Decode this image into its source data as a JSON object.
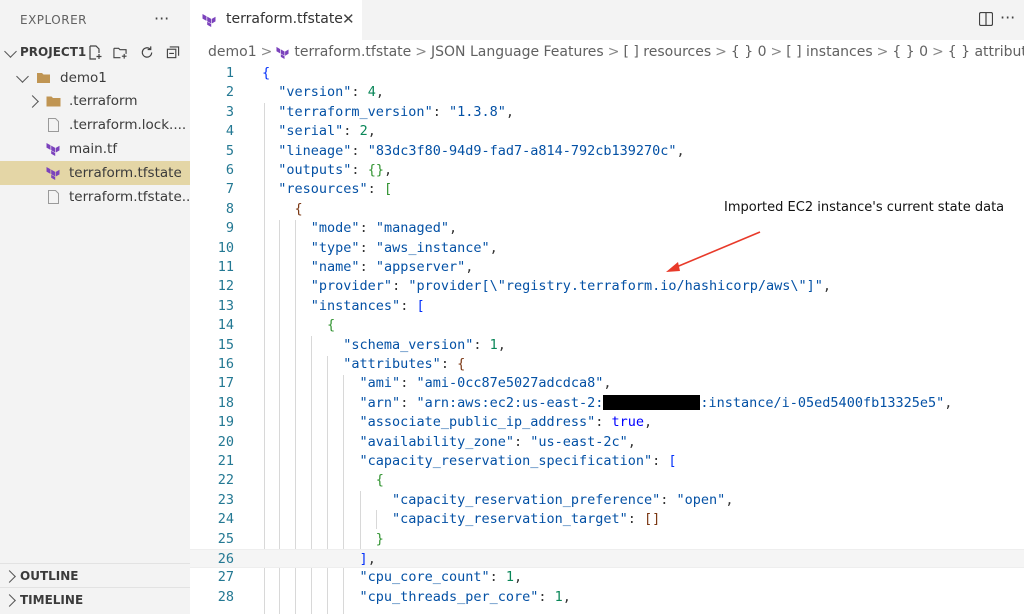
{
  "sidebar": {
    "header": "EXPLORER",
    "more": "···",
    "project": "PROJECT1",
    "tree": [
      {
        "label": "demo1"
      },
      {
        "label": ".terraform"
      },
      {
        "label": ".terraform.lock...."
      },
      {
        "label": "main.tf"
      },
      {
        "label": "terraform.tfstate"
      },
      {
        "label": "terraform.tfstate..."
      }
    ],
    "outline": "OUTLINE",
    "timeline": "TIMELINE"
  },
  "editor": {
    "tab": {
      "label": "terraform.tfstate",
      "close": "✕"
    },
    "more": "···",
    "breadcrumb": {
      "b0": "demo1",
      "b1": "terraform.tfstate",
      "b2": "JSON Language Features",
      "b3": "[ ] resources",
      "b4": "{ } 0",
      "b5": "[ ] instances",
      "b6": "{ } 0",
      "b7": "{ } attributes"
    }
  },
  "annotation": "Imported EC2 instance's current state data",
  "code": {
    "l4_key": "\"serial\"",
    "l5_key": "\"lineage\"",
    "l5_val": "\"83dc3f80-94d9-fad7-a814-792cb139270c\"",
    "l12_val": "\"provider[\\\"registry.terraform.io/hashicorp/aws\\\"]\"",
    "l17_val": "\"ami-0cc87e5027adcdca8\"",
    "l18_pre": "\"arn:aws:ec2:us-east-2:",
    "l18_post": ":instance/i-05ed5400fb13325e5\"",
    "l20_val": "\"us-east-2c\""
  },
  "colors": {
    "selection": "#e4d6a6",
    "terraform_icon": "#7b42bc",
    "folder": "#c09553",
    "annotation_arrow": "#e83a2a"
  }
}
